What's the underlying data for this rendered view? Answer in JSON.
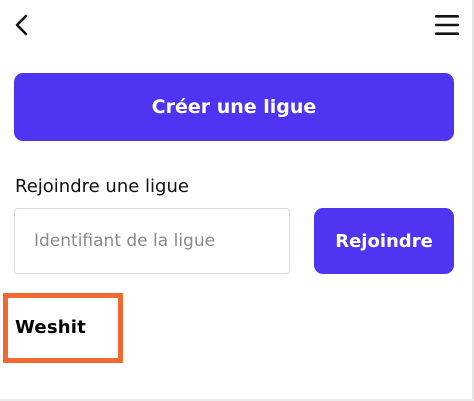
{
  "header": {
    "back_icon": "chevron-left-icon",
    "menu_icon": "hamburger-menu-icon"
  },
  "actions": {
    "create_label": "Créer une ligue",
    "join_section_label": "Rejoindre une ligue",
    "join_input_value": "",
    "join_input_placeholder": "Identifiant de la ligue",
    "join_button_label": "Rejoindre"
  },
  "leagues": [
    {
      "name": "Weshit"
    }
  ],
  "colors": {
    "primary": "#4f35f2",
    "highlight": "#f06a30",
    "text": "#111111",
    "placeholder": "#8a8a8a"
  }
}
